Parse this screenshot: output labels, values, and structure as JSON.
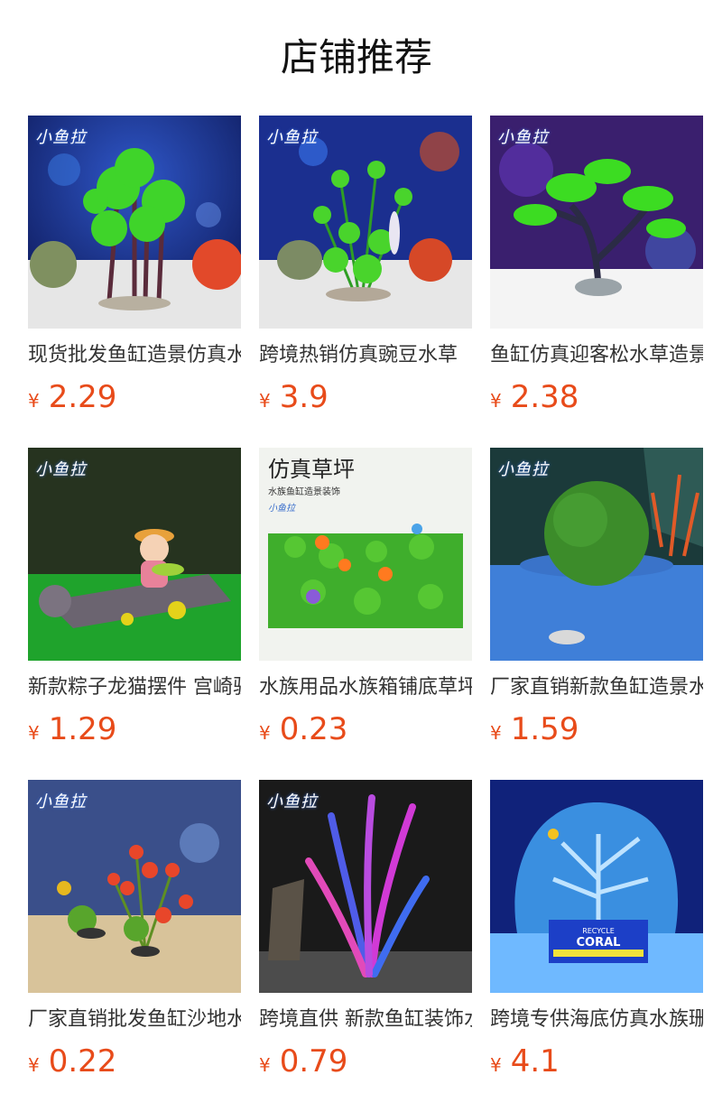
{
  "header": {
    "title": "店铺推荐"
  },
  "currency_symbol": "¥",
  "products": [
    {
      "name": "现货批发鱼缸造景仿真水草",
      "price": "2.29",
      "logo": "小鱼拉",
      "image": "aquarium-palm-trees-photo",
      "scene": "palm"
    },
    {
      "name": "跨境热销仿真豌豆水草",
      "price": "3.9",
      "logo": "小鱼拉",
      "image": "aquarium-pea-plant-photo",
      "scene": "pea"
    },
    {
      "name": "鱼缸仿真迎客松水草造景",
      "price": "2.38",
      "logo": "小鱼拉",
      "image": "aquarium-bonsai-pine-photo",
      "scene": "pine"
    },
    {
      "name": "新款粽子龙猫摆件 宫崎骏",
      "price": "1.29",
      "logo": "小鱼拉",
      "image": "aquarium-figurine-log-photo",
      "scene": "figure"
    },
    {
      "name": "水族用品水族箱铺底草坪",
      "price": "0.23",
      "logo": "",
      "image": "artificial-lawn-mat-photo",
      "scene": "lawn"
    },
    {
      "name": "厂家直销新款鱼缸造景水草球",
      "price": "1.59",
      "logo": "小鱼拉",
      "image": "aquarium-moss-ball-photo",
      "scene": "moss"
    },
    {
      "name": "厂家直销批发鱼缸沙地水草",
      "price": "0.22",
      "logo": "小鱼拉",
      "image": "aquarium-red-plant-photo",
      "scene": "red"
    },
    {
      "name": "跨境直供 新款鱼缸装饰水草",
      "price": "0.79",
      "logo": "小鱼拉",
      "image": "aquarium-pink-seaweed-photo",
      "scene": "seaweed"
    },
    {
      "name": "跨境专供海底仿真水族珊瑚",
      "price": "4.1",
      "logo": "",
      "image": "aquarium-blue-coral-photo",
      "scene": "coral"
    }
  ],
  "lawn_banner": {
    "title": "仿真草坪",
    "subtitle": "水族鱼缸造景装饰",
    "logo": "小鱼拉"
  },
  "coral_box": {
    "line1": "RECYCLE",
    "line2": "CORAL"
  },
  "colors": {
    "price": "#e84b1a",
    "title": "#111111",
    "text": "#333333"
  }
}
